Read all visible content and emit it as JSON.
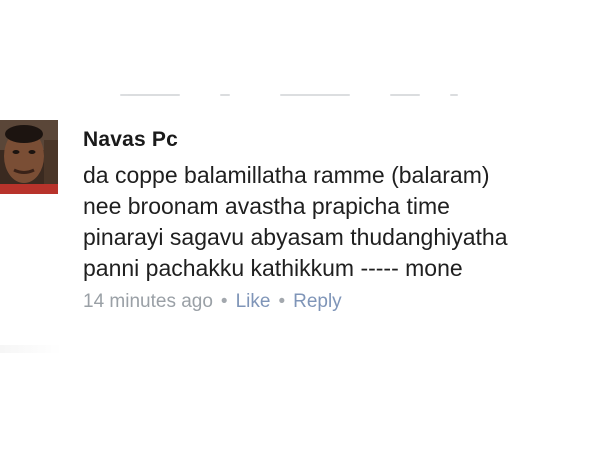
{
  "comment": {
    "author": "Navas Pc",
    "lines": [
      "da coppe balamillatha ramme  (balaram)",
      "nee broonam avastha prapicha time",
      "pinarayi sagavu abyasam thudanghiyatha",
      "panni pachakku kathikkum ----- mone"
    ],
    "timestamp": "14 minutes ago",
    "separator": "•",
    "like_label": "Like",
    "reply_label": "Reply",
    "avatar_icon": "profile-photo",
    "colors": {
      "author": "#1a1a1a",
      "body": "#1f1f1f",
      "meta": "#8f959e",
      "action": "#7f95b8"
    }
  }
}
